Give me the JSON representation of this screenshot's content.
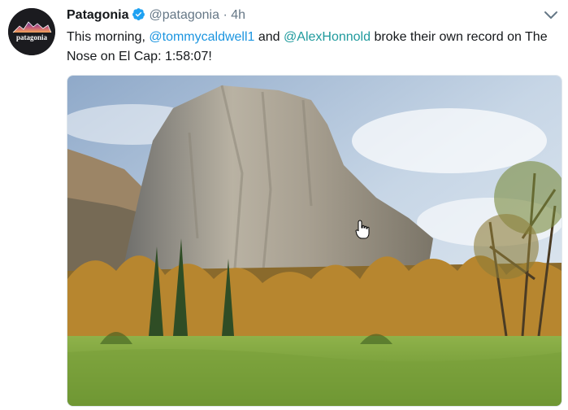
{
  "tweet": {
    "display_name": "Patagonia",
    "handle": "@patagonia",
    "separator": "·",
    "time": "4h",
    "text_before": "This morning, ",
    "mention_1": "@tommycaldwell1",
    "text_middle": " and ",
    "mention_2": "@AlexHonnold",
    "text_after": " broke their own record on The Nose on El Cap: 1:58:07!",
    "verified": true
  },
  "avatar": {
    "logo_text": "patagonia",
    "background_color": "#1b1b1f"
  },
  "media": {
    "image_subject": "El Capitan rock face above a meadow with autumn trees"
  },
  "icons": {
    "verified": "verified-badge-icon",
    "menu": "chevron-down-icon",
    "cursor": "hand-pointer-icon"
  },
  "colors": {
    "link_blue": "#1b95e0",
    "link_teal": "#1f9a9d",
    "text": "#14171a",
    "muted": "#657786"
  }
}
